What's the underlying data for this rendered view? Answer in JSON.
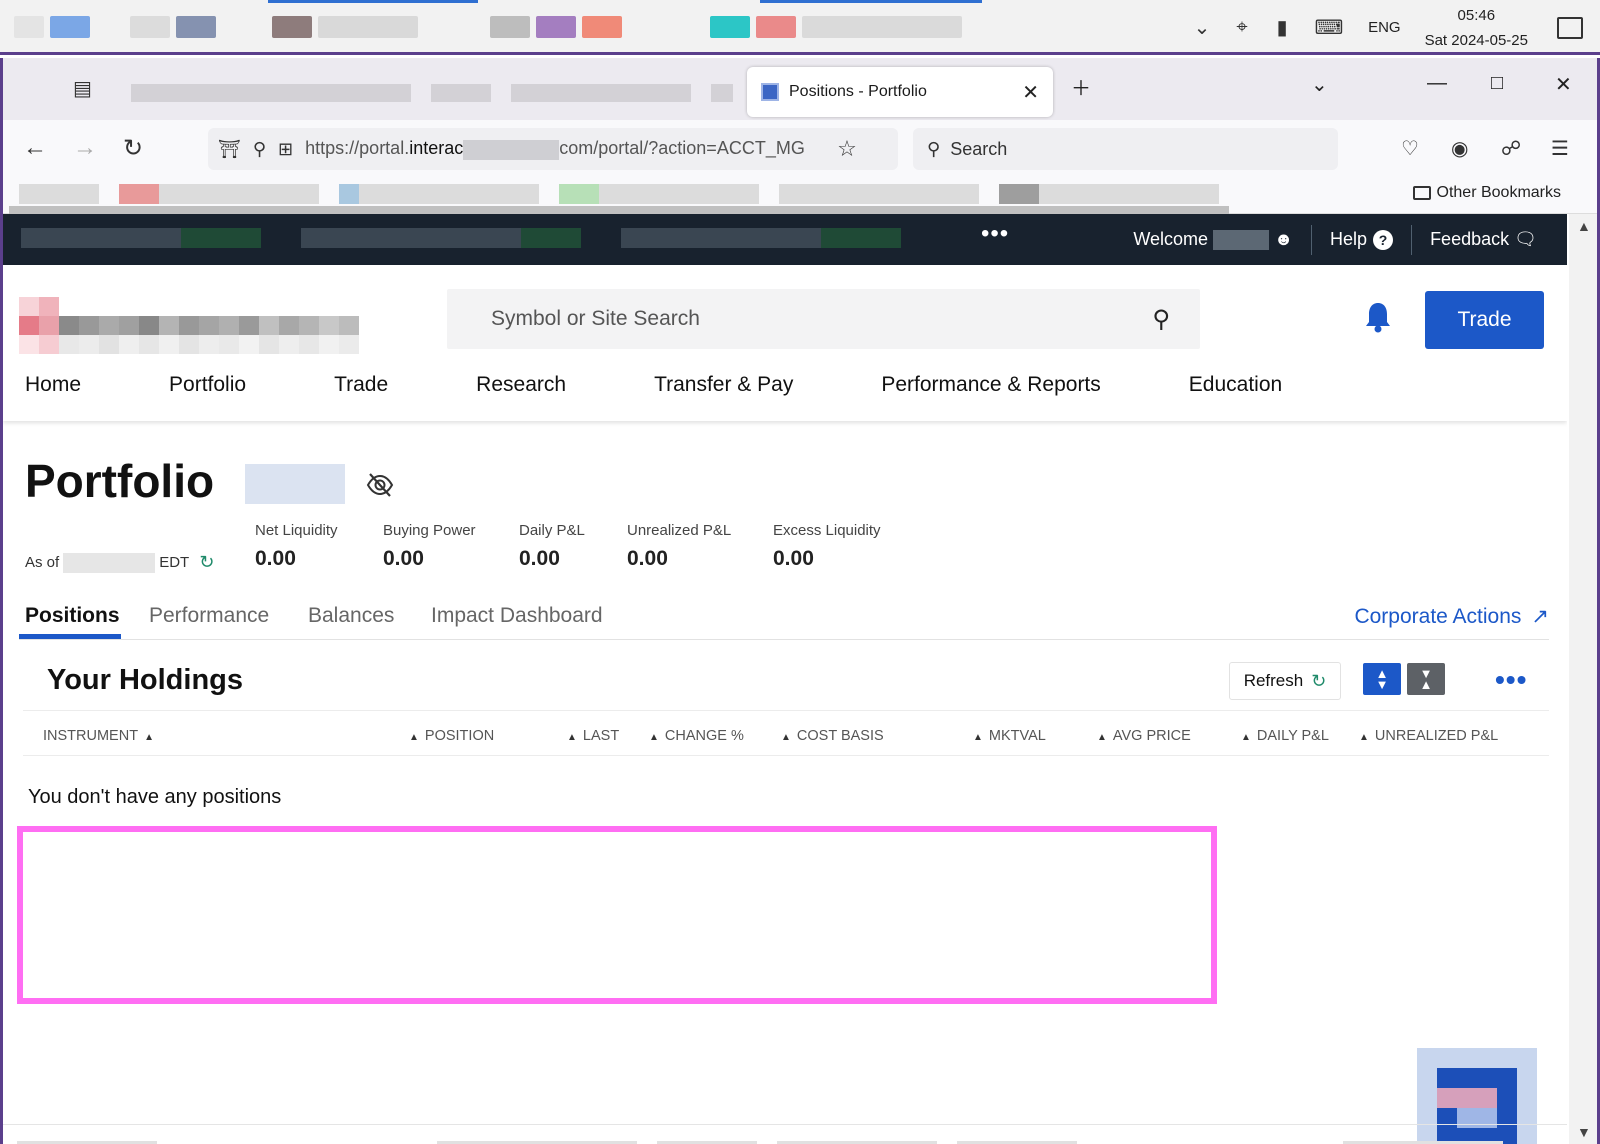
{
  "taskbar": {
    "lang": "ENG",
    "time": "05:46",
    "date": "Sat 2024-05-25"
  },
  "browser": {
    "active_tab_title": "Positions - Portfolio",
    "url_prefix": "https://portal.",
    "url_host": "interac",
    "url_suffix": "com/portal/?action=ACCT_MG",
    "search_placeholder": "Search",
    "other_bookmarks": "Other Bookmarks"
  },
  "topbar": {
    "welcome": "Welcome",
    "help": "Help",
    "feedback": "Feedback"
  },
  "header": {
    "search_placeholder": "Symbol or Site Search",
    "trade_button": "Trade",
    "nav": [
      "Home",
      "Portfolio",
      "Trade",
      "Research",
      "Transfer & Pay",
      "Performance & Reports",
      "Education"
    ]
  },
  "portfolio": {
    "title": "Portfolio",
    "as_of_prefix": "As of",
    "as_of_suffix": "EDT",
    "metrics": [
      {
        "label": "Net Liquidity",
        "value": "0.00"
      },
      {
        "label": "Buying Power",
        "value": "0.00"
      },
      {
        "label": "Daily P&L",
        "value": "0.00"
      },
      {
        "label": "Unrealized P&L",
        "value": "0.00"
      },
      {
        "label": "Excess Liquidity",
        "value": "0.00"
      }
    ],
    "tabs": [
      "Positions",
      "Performance",
      "Balances",
      "Impact Dashboard"
    ],
    "corporate_actions": "Corporate Actions"
  },
  "holdings": {
    "title": "Your Holdings",
    "refresh": "Refresh",
    "columns": [
      "INSTRUMENT",
      "POSITION",
      "LAST",
      "CHANGE %",
      "COST BASIS",
      "MKTVAL",
      "AVG PRICE",
      "DAILY P&L",
      "UNREALIZED P&L"
    ],
    "empty_message": "You don't have any positions"
  },
  "colors": {
    "brand_blue": "#1c58c8",
    "dark_bar": "#18222e",
    "highlight_box": "#ff6ef3"
  }
}
